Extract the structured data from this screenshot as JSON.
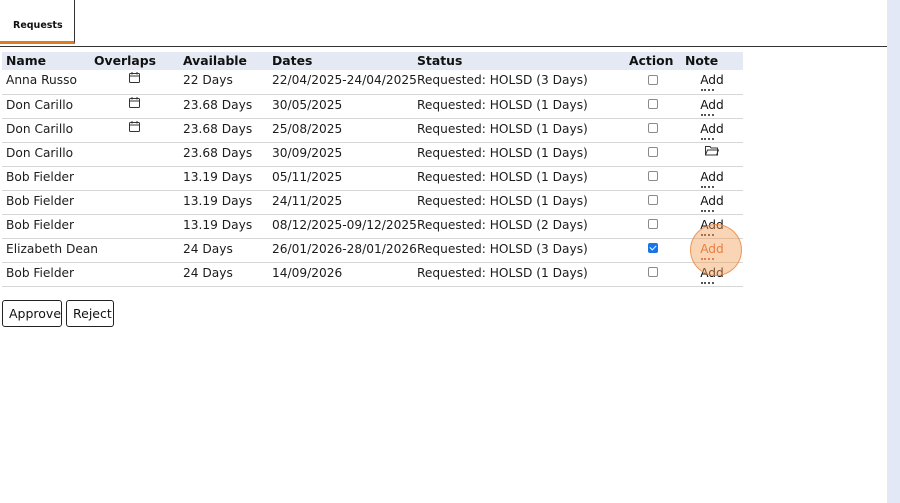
{
  "tabs": [
    {
      "label": "Requests",
      "active": true
    }
  ],
  "table": {
    "columns": [
      "Name",
      "Overlaps",
      "Available",
      "Dates",
      "Status",
      "Action",
      "Note"
    ],
    "rows": [
      {
        "name": "Anna Russo",
        "overlaps": true,
        "available": "22 Days",
        "dates": "22/04/2025-24/04/2025",
        "status": "Requested: HOLSD (3 Days)",
        "action_checked": false,
        "note": "Add",
        "note_icon": null
      },
      {
        "name": "Don Carillo",
        "overlaps": true,
        "available": "23.68 Days",
        "dates": "30/05/2025",
        "status": "Requested: HOLSD (1 Days)",
        "action_checked": false,
        "note": "Add",
        "note_icon": null
      },
      {
        "name": "Don Carillo",
        "overlaps": true,
        "available": "23.68 Days",
        "dates": "25/08/2025",
        "status": "Requested: HOLSD (1 Days)",
        "action_checked": false,
        "note": "Add",
        "note_icon": null
      },
      {
        "name": "Don Carillo",
        "overlaps": false,
        "available": "23.68 Days",
        "dates": "30/09/2025",
        "status": "Requested: HOLSD (1 Days)",
        "action_checked": false,
        "note": "",
        "note_icon": "folder-icon"
      },
      {
        "name": "Bob Fielder",
        "overlaps": false,
        "available": "13.19 Days",
        "dates": "05/11/2025",
        "status": "Requested: HOLSD (1 Days)",
        "action_checked": false,
        "note": "Add",
        "note_icon": null
      },
      {
        "name": "Bob Fielder",
        "overlaps": false,
        "available": "13.19 Days",
        "dates": "24/11/2025",
        "status": "Requested: HOLSD (1 Days)",
        "action_checked": false,
        "note": "Add",
        "note_icon": null
      },
      {
        "name": "Bob Fielder",
        "overlaps": false,
        "available": "13.19 Days",
        "dates": "08/12/2025-09/12/2025",
        "status": "Requested: HOLSD (2 Days)",
        "action_checked": false,
        "note": "Add",
        "note_icon": null
      },
      {
        "name": "Elizabeth Dean",
        "overlaps": false,
        "available": "24 Days",
        "dates": "26/01/2026-28/01/2026",
        "status": "Requested: HOLSD (3 Days)",
        "action_checked": true,
        "note": "Add",
        "note_icon": null,
        "note_active": true
      },
      {
        "name": "Bob Fielder",
        "overlaps": false,
        "available": "24 Days",
        "dates": "14/09/2026",
        "status": "Requested: HOLSD (1 Days)",
        "action_checked": false,
        "note": "Add",
        "note_icon": null
      }
    ]
  },
  "buttons": {
    "approve": "Approve",
    "reject": "Reject"
  },
  "colors": {
    "accent": "#e07a1f",
    "header_bg": "#e4e9f3",
    "checkbox_checked": "#1a73e8",
    "side_strip": "#e2e8f5"
  }
}
